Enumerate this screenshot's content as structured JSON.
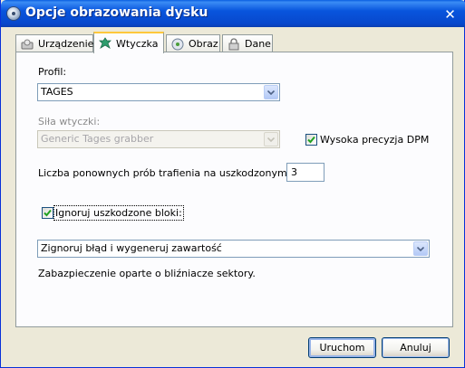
{
  "window": {
    "title": "Opcje obrazowania dysku",
    "close_glyph": "✕"
  },
  "tabs": [
    {
      "label": "Urządzenie",
      "icon": "device-icon",
      "active": false
    },
    {
      "label": "Wtyczka",
      "icon": "plugin-icon",
      "active": true
    },
    {
      "label": "Obraz",
      "icon": "image-icon",
      "active": false
    },
    {
      "label": "Dane",
      "icon": "data-lock-icon",
      "active": false
    }
  ],
  "plugin": {
    "profile_label": "Profil:",
    "profile_value": "TAGES",
    "strength_label": "Siła wtyczki:",
    "strength_value": "Generic Tages grabber",
    "high_precision_dpm_label": "Wysoka precyzja DPM",
    "high_precision_dpm_checked": true,
    "retries_label": "Liczba ponownych prób trafienia na uszkodzonym bloku:",
    "retries_value": "3",
    "ignore_bad_blocks_label": "Ignoruj uszkodzone bloki:",
    "ignore_bad_blocks_checked": true,
    "bad_block_action_value": "Zignoruj błąd i wygeneruj zawartość",
    "description": "Zabazpieczenie oparte o bliźniacze sektory."
  },
  "buttons": {
    "run_label": "Uruchom",
    "cancel_label": "Anuluj"
  },
  "colors": {
    "titlebar": "#0855dd",
    "window_bg": "#ece9d8",
    "panel_bg": "#fcfcfe",
    "active_tab_accent": "#ffc83c",
    "check_mark": "#21a121"
  }
}
